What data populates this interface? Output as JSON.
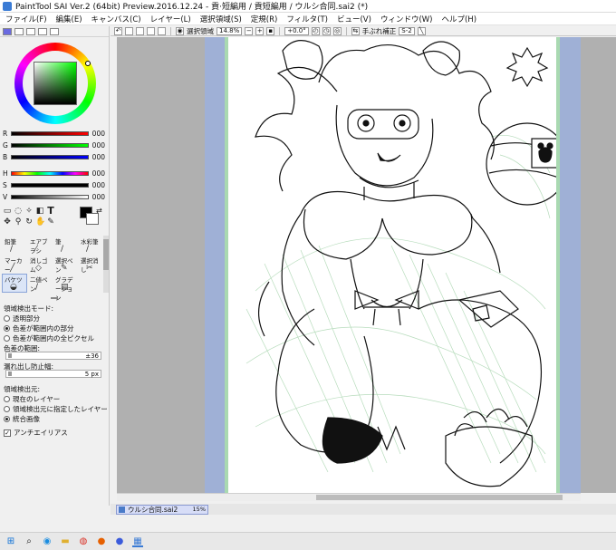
{
  "window": {
    "title": "PaintTool SAI Ver.2 (64bit) Preview.2016.12.24 - 貢·短編用 / 貢短編用 / ウルシ合同.sai2 (*)"
  },
  "menu": [
    "ファイル(F)",
    "編集(E)",
    "キャンバス(C)",
    "レイヤー(L)",
    "選択領域(S)",
    "定規(R)",
    "フィルタ(T)",
    "ビュー(V)",
    "ウィンドウ(W)",
    "ヘルプ(H)"
  ],
  "color_panel": {
    "sliders": [
      {
        "label": "R",
        "value": "000"
      },
      {
        "label": "G",
        "value": "000"
      },
      {
        "label": "B",
        "value": "000"
      },
      {
        "label": "H",
        "value": "000"
      },
      {
        "label": "S",
        "value": "000"
      },
      {
        "label": "V",
        "value": "000"
      }
    ],
    "main_color": "#000000",
    "sub_color": "#ffffff"
  },
  "brushes": [
    {
      "label": "鉛筆",
      "icon": "pencil-icon"
    },
    {
      "label": "エアブラシ",
      "icon": "airbrush-icon"
    },
    {
      "label": "筆",
      "icon": "brush-icon"
    },
    {
      "label": "水彩筆",
      "icon": "watercolor-icon"
    },
    {
      "label": "マーカー",
      "icon": "marker-icon"
    },
    {
      "label": "消しゴム",
      "icon": "eraser-icon"
    },
    {
      "label": "選択ペン",
      "icon": "selection-pen-icon"
    },
    {
      "label": "選択消し",
      "icon": "selection-erase-icon"
    },
    {
      "label": "バケツ",
      "icon": "bucket-icon",
      "selected": true
    },
    {
      "label": "二値ペン",
      "icon": "binary-pen-icon"
    },
    {
      "label": "グラデーション",
      "icon": "gradient-icon"
    },
    {
      "label": "",
      "icon": ""
    }
  ],
  "options": {
    "detect_mode_label": "領域検出モード:",
    "detect_modes": [
      {
        "label": "透明部分",
        "checked": false
      },
      {
        "label": "色差が範囲内の部分",
        "checked": true
      },
      {
        "label": "色差が範囲内の全ピクセル",
        "checked": false
      }
    ],
    "color_range_label": "色差の範囲:",
    "color_range_value": "±36",
    "leak_label": "漏れ出し防止幅:",
    "leak_value": "5 px",
    "detect_source_label": "領域検出元:",
    "detect_sources": [
      {
        "label": "現在のレイヤー",
        "checked": false
      },
      {
        "label": "領域検出元に指定したレイヤー",
        "checked": false
      },
      {
        "label": "統合画像",
        "checked": true
      }
    ],
    "antialias_label": "アンチエイリアス",
    "antialias_checked": true
  },
  "toolbar": {
    "selection_label": "選択領域",
    "zoom": "14.8%",
    "rotation": "+0.0°",
    "stabilizer_label": "手ぶれ補正",
    "stabilizer_value": "S-2"
  },
  "file_tab": {
    "name": "ウルシ合同.sai2",
    "zoom": "15%"
  },
  "taskbar": [
    "windows-start-icon",
    "search-icon",
    "edge-icon",
    "folder-icon",
    "chrome-icon",
    "firefox-icon",
    "firefox-dev-icon",
    "sai-icon"
  ]
}
